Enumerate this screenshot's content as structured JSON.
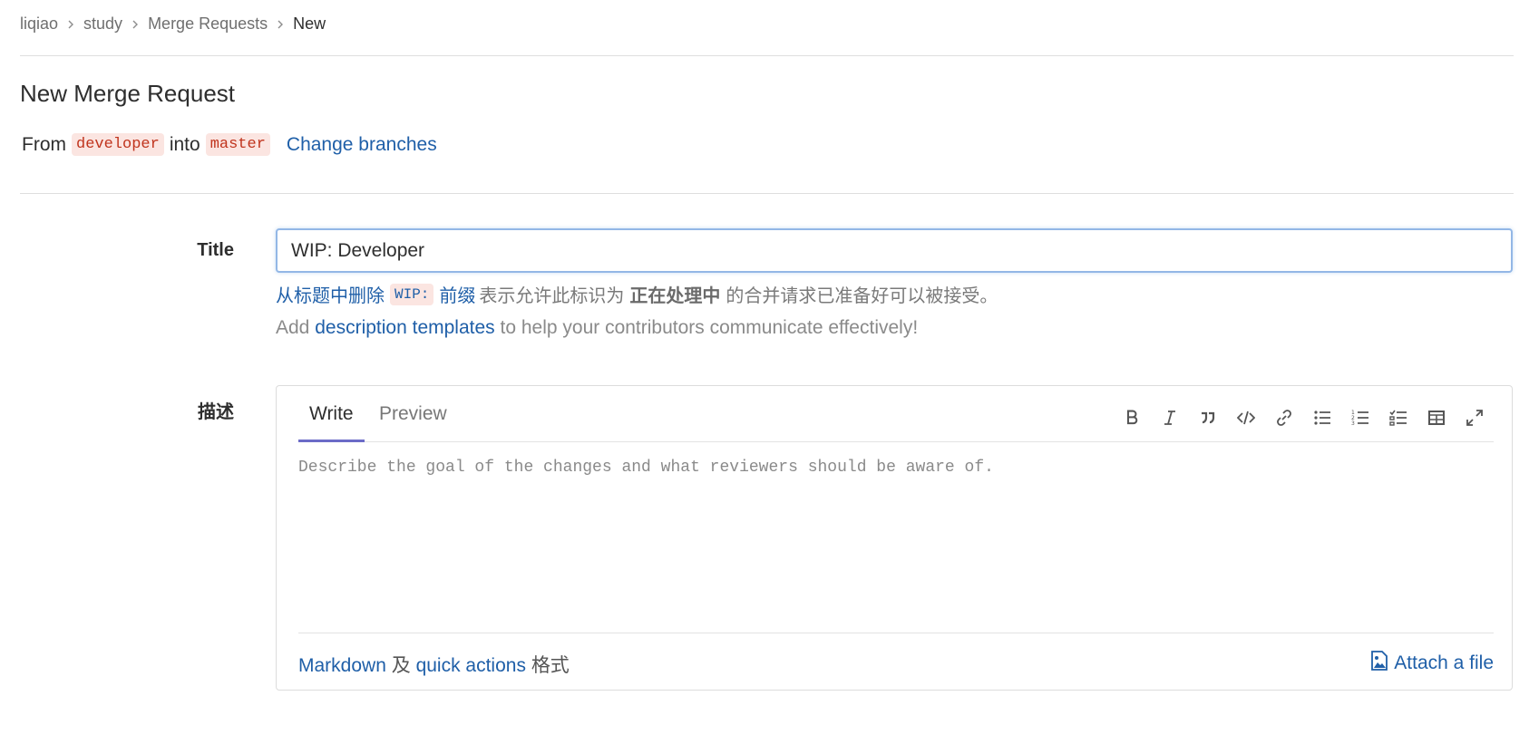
{
  "breadcrumb": [
    "liqiao",
    "study",
    "Merge Requests",
    "New"
  ],
  "page_title": "New Merge Request",
  "branches": {
    "from_label": "From",
    "source": "developer",
    "into_label": "into",
    "target": "master",
    "change_link": "Change branches"
  },
  "title_field": {
    "label": "Title",
    "value": "WIP: Developer"
  },
  "wip_hint": {
    "link_remove": "从标题中删除",
    "code": "WIP:",
    "link_prefix": "前缀",
    "text_1": "表示允许此标识为",
    "bold": "正在处理中",
    "text_2": "的合并请求已准备好可以被接受。"
  },
  "templates_hint": {
    "prefix": "Add",
    "link": "description templates",
    "suffix": "to help your contributors communicate effectively!"
  },
  "description": {
    "label": "描述",
    "tabs": [
      "Write",
      "Preview"
    ],
    "placeholder": "Describe the goal of the changes and what reviewers should be aware of.",
    "toolbar_icons": [
      "bold-icon",
      "italic-icon",
      "quote-icon",
      "code-icon",
      "link-icon",
      "bulleted-list-icon",
      "numbered-list-icon",
      "task-list-icon",
      "table-icon",
      "fullscreen-icon"
    ],
    "footer": {
      "markdown_link": "Markdown",
      "and": "及",
      "quick_actions_link": "quick actions",
      "format": "格式",
      "attach": "Attach a file"
    }
  },
  "colors": {
    "link": "#1f5fa8",
    "code_text": "#c0341d",
    "code_bg": "#fbe5e1",
    "active_tab": "#6b6bc7",
    "input_focus": "#93b7e6"
  }
}
